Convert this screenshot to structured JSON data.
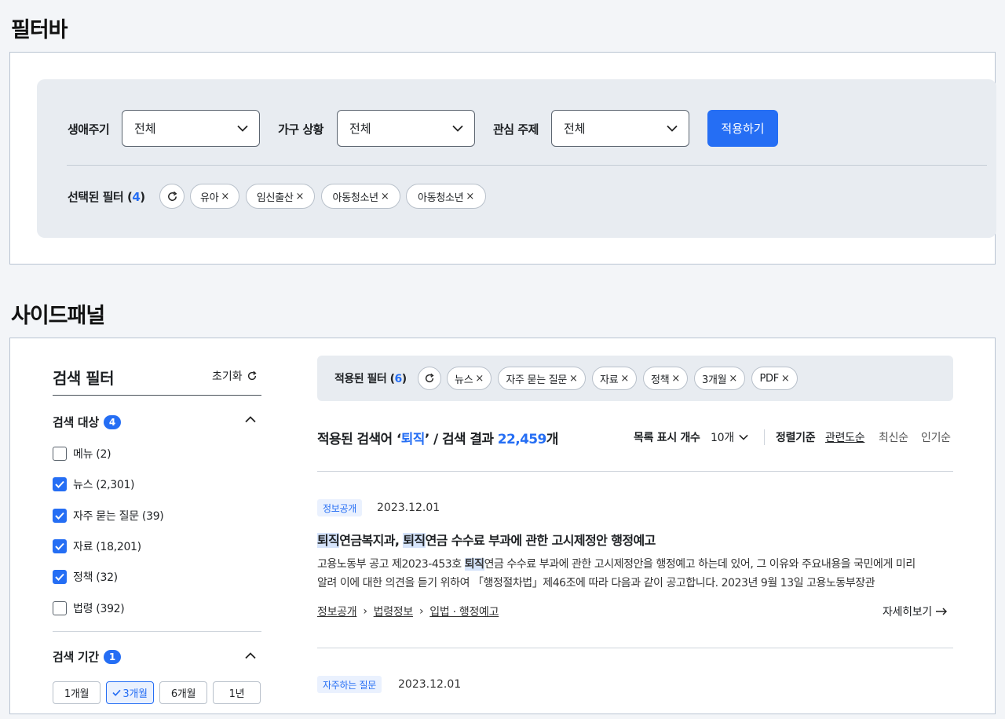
{
  "filter_bar": {
    "heading": "필터바",
    "selects": [
      {
        "label": "생애주기",
        "value": "전체"
      },
      {
        "label": "가구 상황",
        "value": "전체"
      },
      {
        "label": "관심 주제",
        "value": "전체"
      }
    ],
    "apply_label": "적용하기",
    "selected_label": "선택된 필터 (",
    "selected_count": "4",
    "selected_close": ")",
    "chips": [
      "유아",
      "임신출산",
      "아동청소년",
      "아동청소년"
    ]
  },
  "side_panel": {
    "heading": "사이드패널",
    "title": "검색 필터",
    "reset_label": "초기화",
    "target": {
      "title": "검색 대상",
      "badge": "4",
      "options": [
        {
          "label": "메뉴 (2)",
          "checked": false
        },
        {
          "label": "뉴스 (2,301)",
          "checked": true
        },
        {
          "label": "자주 묻는 질문 (39)",
          "checked": true
        },
        {
          "label": "자료 (18,201)",
          "checked": true
        },
        {
          "label": "정책 (32)",
          "checked": true
        },
        {
          "label": "법령 (392)",
          "checked": false
        }
      ]
    },
    "period": {
      "title": "검색 기간",
      "badge": "1",
      "options": [
        "1개월",
        "3개월",
        "6개월",
        "1년"
      ],
      "selected_index": 1
    }
  },
  "results": {
    "applied_label": "적용된 필터 (",
    "applied_count": "6",
    "applied_close": ")",
    "applied_chips": [
      "뉴스",
      "자주 묻는 질문",
      "자료",
      "정책",
      "3개월",
      "PDF"
    ],
    "summary_prefix": "적용된 검색어 ‘",
    "keyword": "퇴직",
    "summary_middle": "’ / 검색 결과 ",
    "count": "22,459",
    "count_suffix": "개",
    "page_size_label": "목록 표시 개수",
    "page_size_value": "10개",
    "sort_label": "정렬기준",
    "sort_options": [
      "관련도순",
      "최신순",
      "인기순"
    ],
    "items": [
      {
        "category": "정보공개",
        "date": "2023.12.01",
        "title_parts": [
          "퇴직",
          "연금복지과, ",
          "퇴직",
          "연금 수수료 부과에 관한 고시제정안 행정예고"
        ],
        "desc_line1_parts": [
          "고용노동부 공고 제2023-453호 ",
          "퇴직",
          "연금 수수료 부과에 관한 고시제정안을 행정예고 하는데 있어, 그 이유와 주요내용을 국민에게 미리"
        ],
        "desc_line2": "알려 이에 대한 의견을 듣기 위하여 「행정절차법」제46조에 따라 다음과 같이 공고합니다. 2023년 9월 13일 고용노동부장관",
        "breadcrumb": [
          "정보공개",
          "법령정보",
          "입법 · 행정예고"
        ],
        "more_label": "자세히보기"
      },
      {
        "category": "자주하는 질문",
        "date": "2023.12.01"
      }
    ]
  },
  "colors": {
    "accent": "#256ef4",
    "panel_bg": "#e8ecf1",
    "frame_border": "#b9c4d2"
  }
}
